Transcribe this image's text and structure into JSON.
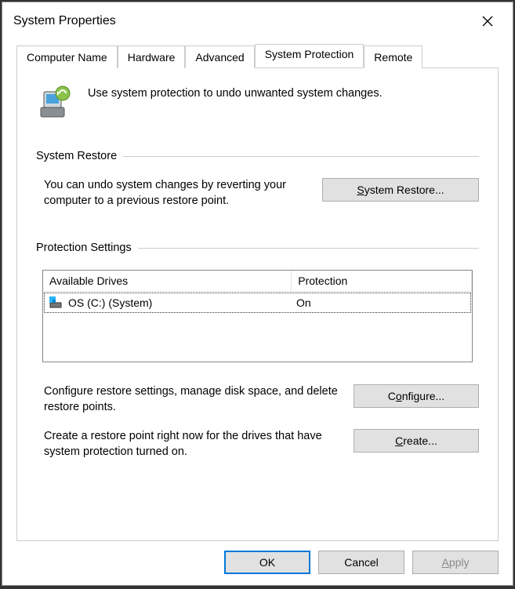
{
  "window": {
    "title": "System Properties"
  },
  "tabs": {
    "computer_name": "Computer Name",
    "hardware": "Hardware",
    "advanced": "Advanced",
    "system_protection": "System Protection",
    "remote": "Remote"
  },
  "intro": {
    "text": "Use system protection to undo unwanted system changes."
  },
  "restore": {
    "heading": "System Restore",
    "desc": "You can undo system changes by reverting your computer to a previous restore point.",
    "button": "System Restore..."
  },
  "settings": {
    "heading": "Protection Settings",
    "col_drives": "Available Drives",
    "col_protection": "Protection",
    "rows": [
      {
        "name": "OS (C:) (System)",
        "protection": "On"
      }
    ],
    "configure_desc": "Configure restore settings, manage disk space, and delete restore points.",
    "configure_btn": "Configure...",
    "create_desc": "Create a restore point right now for the drives that have system protection turned on.",
    "create_btn": "Create..."
  },
  "footer": {
    "ok": "OK",
    "cancel": "Cancel",
    "apply": "Apply"
  }
}
